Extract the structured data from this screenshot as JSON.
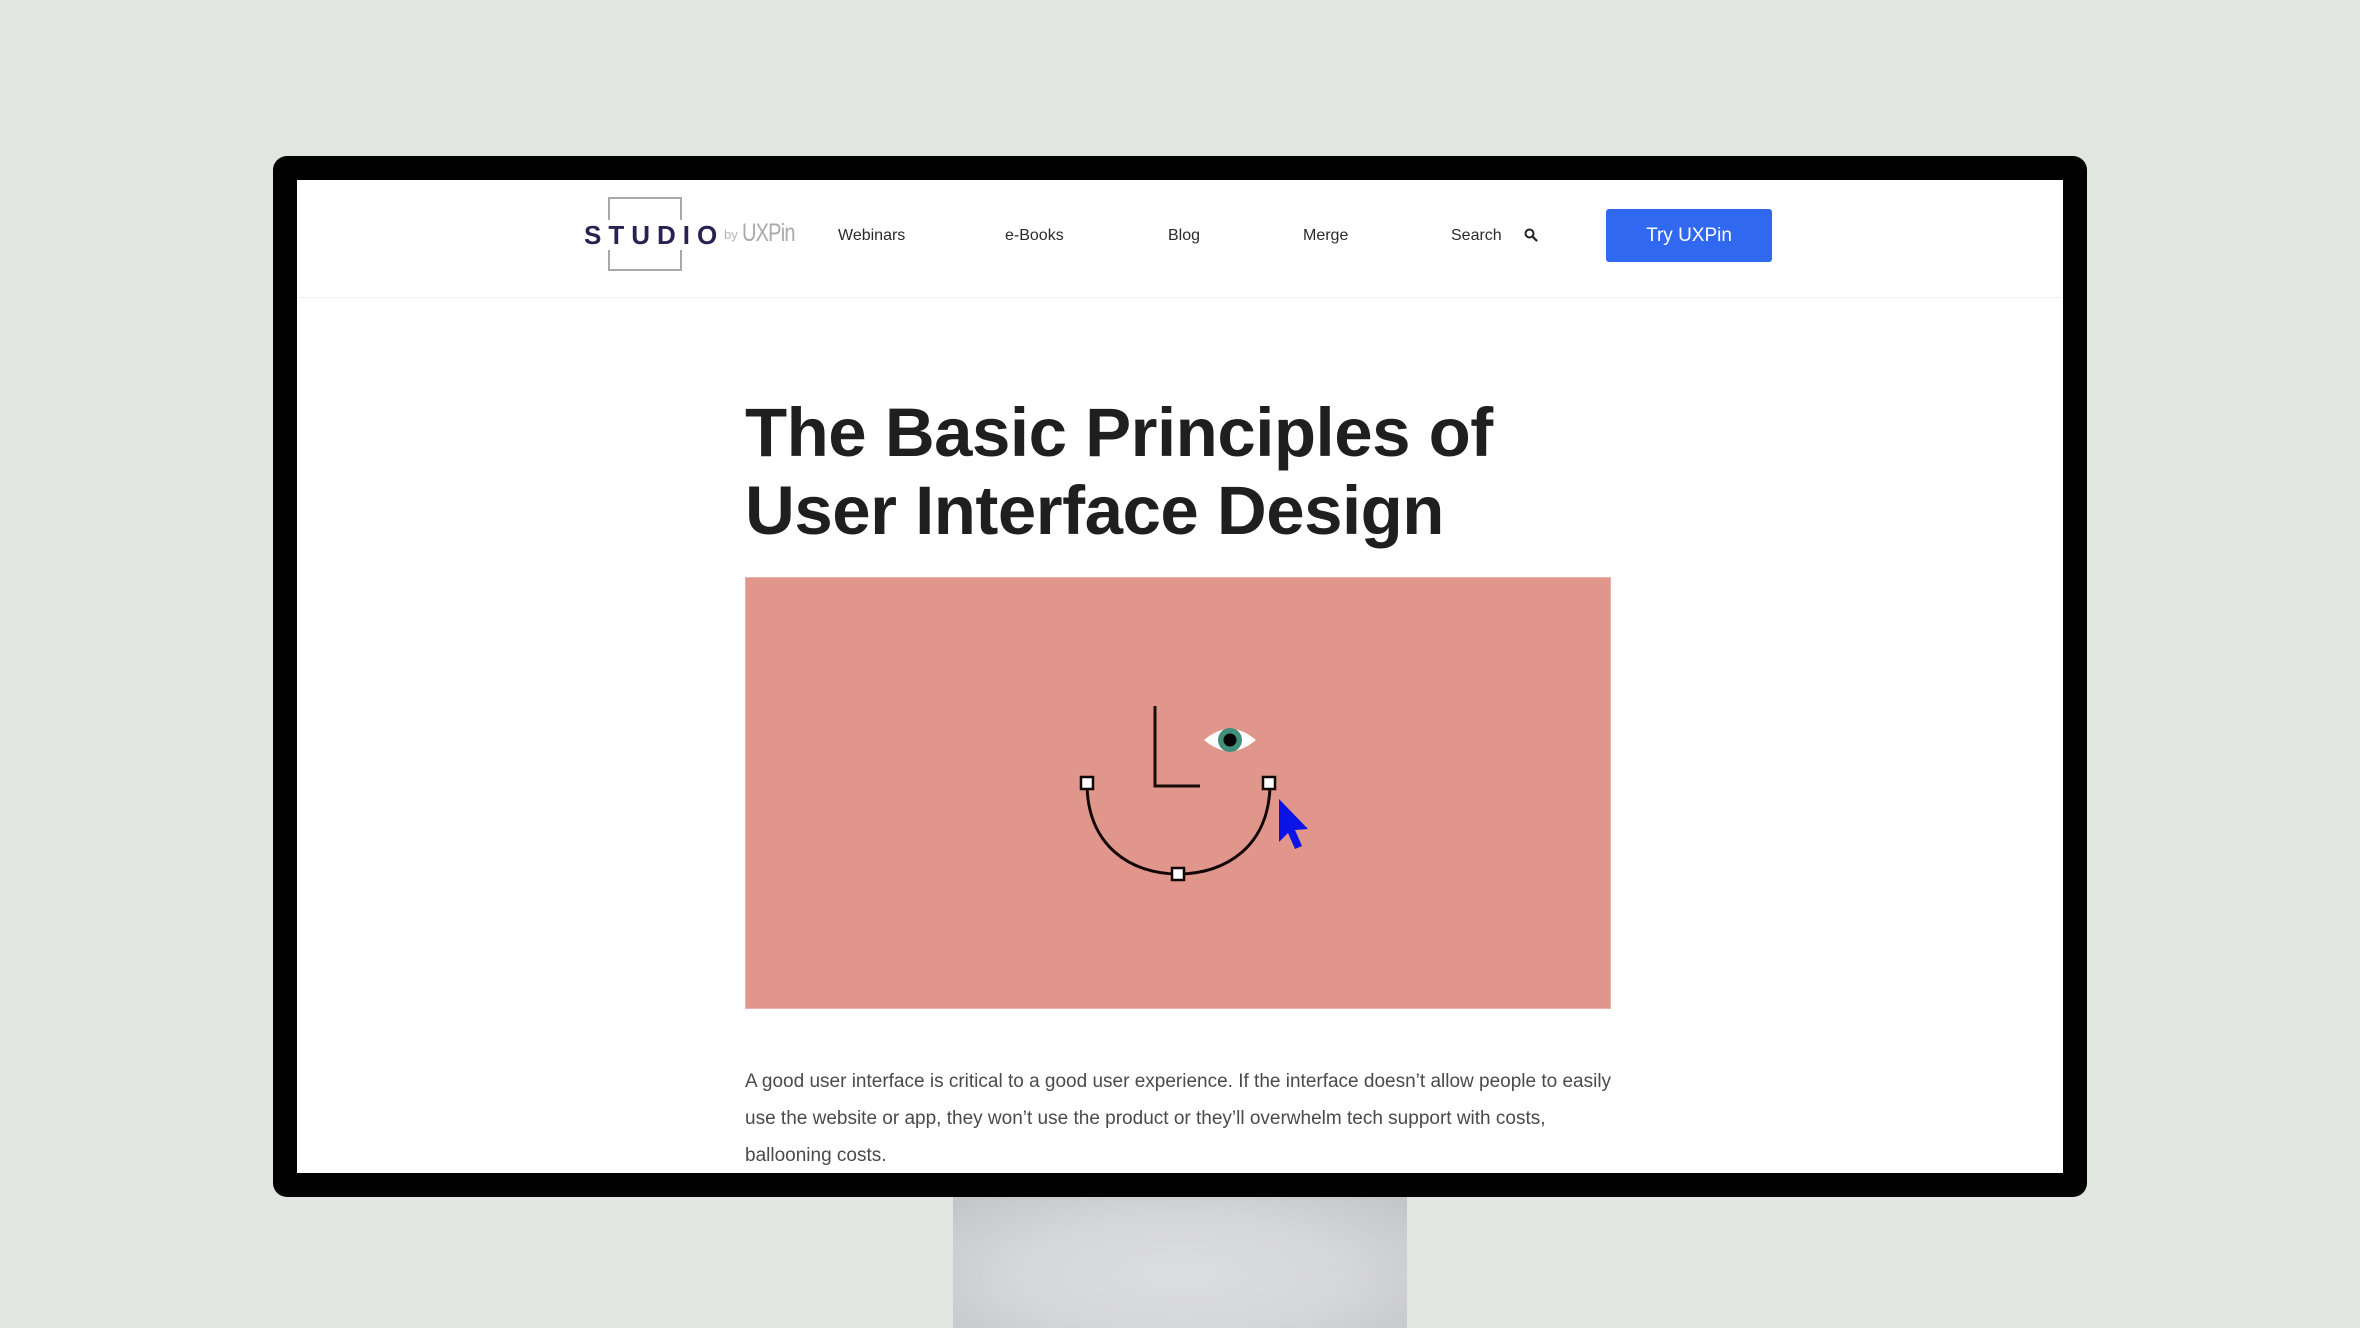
{
  "site": {
    "logo": {
      "wordmark": "STUDIO",
      "by": "by",
      "brand": "UXPin"
    },
    "nav": {
      "items": [
        {
          "label": "Webinars"
        },
        {
          "label": "e-Books"
        },
        {
          "label": "Blog"
        },
        {
          "label": "Merge"
        },
        {
          "label": "Search"
        }
      ],
      "search_icon": "search-icon",
      "cta_label": "Try UXPin"
    }
  },
  "article": {
    "title": "The Basic Principles of User Interface Design",
    "hero_image": {
      "description": "Illustration of a smiling face drawn as a vector path with anchor points, an eye, and a blue mouse cursor",
      "background_color": "#e0968a",
      "cursor_color": "#0a14e6",
      "iris_color": "#3f8f7a"
    },
    "intro_paragraph": "A good user interface is critical to a good user experience. If the interface doesn’t allow people to easily use the website or app, they won’t use the product or they’ll overwhelm tech support with costs, ballooning costs."
  },
  "colors": {
    "background": "#e1e6e0",
    "bezel": "#020202",
    "cta": "#3069f0",
    "logo_text": "#262352"
  }
}
